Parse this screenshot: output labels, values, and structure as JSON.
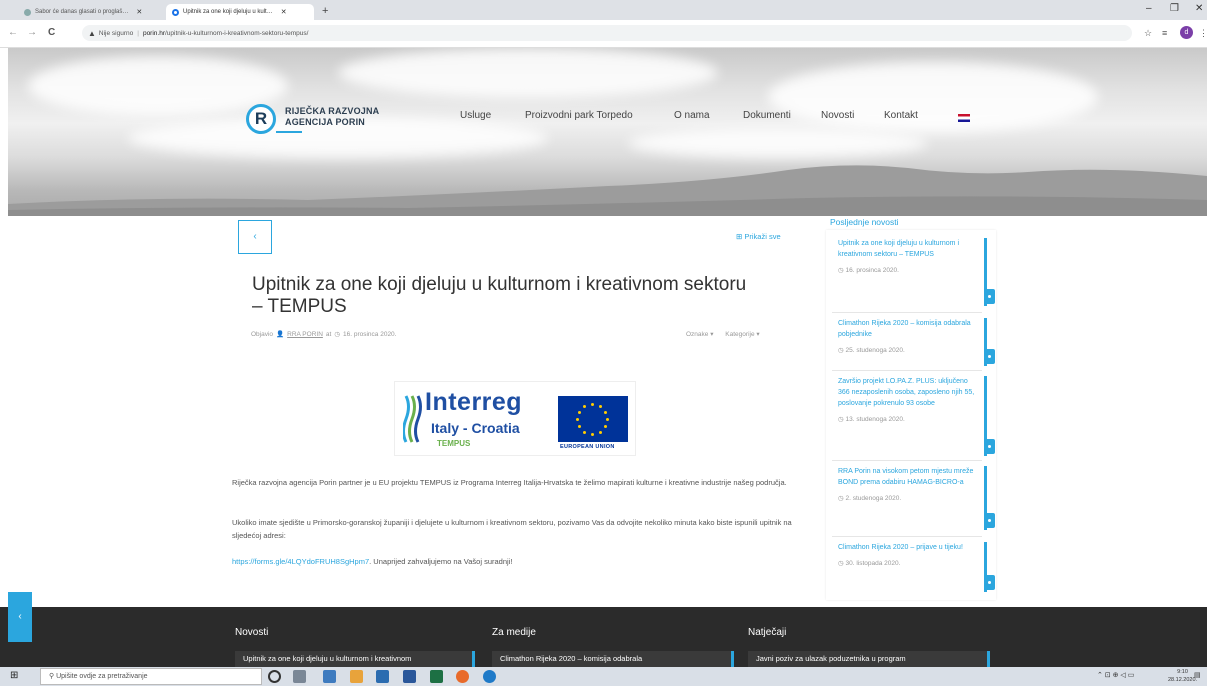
{
  "browser": {
    "tabs": [
      {
        "title": "Sabor će danas glasati o proglaš…",
        "active": false
      },
      {
        "title": "Upitnik za one koji djeluju u kult…",
        "active": true
      }
    ],
    "new_tab_label": "+",
    "window_controls": {
      "minimize": "–",
      "maximize": "❐",
      "close": "✕"
    },
    "nav": {
      "back": "←",
      "forward": "→",
      "reload": "C"
    },
    "url": {
      "security_icon": "warning-triangle-icon",
      "security_text": "Nije sigurno",
      "host": "porin.hr",
      "path": "/upitnik-u-kulturnom-i-kreativnom-sektoru-tempus/"
    },
    "toolbar_icons": {
      "star": "☆",
      "reading_list": "≡",
      "profile": "d",
      "menu": "⋮"
    }
  },
  "site": {
    "logo_letter": "R",
    "logo_line1": "RIJEČKA RAZVOJNA",
    "logo_line2": "AGENCIJA PORIN",
    "menu": [
      "Usluge",
      "Proizvodni park Torpedo",
      "O nama",
      "Dokumenti",
      "Novosti",
      "Kontakt"
    ]
  },
  "article": {
    "back_label": "‹",
    "show_all_label": "Prikaži sve",
    "title": "Upitnik za one koji djeluju u kulturnom i kreativnom sektoru – TEMPUS",
    "meta": {
      "posted_prefix": "Objavio",
      "author": "RRA PORIN",
      "at": "at",
      "date": "16. prosinca 2020.",
      "tags_label": "Oznake",
      "categories_label": "Kategorije"
    },
    "banner": {
      "line1": "Interreg",
      "line2": "Italy - Croatia",
      "line3": "TEMPUS",
      "eu_label": "EUROPEAN UNION"
    },
    "paragraph1": "Riječka razvojna agencija Porin partner je u EU projektu TEMPUS iz Programa Interreg Italija-Hrvatska te želimo mapirati kulturne i kreativne industrije našeg područja.",
    "paragraph2": "Ukoliko imate sjedište u Primorsko-goranskoj županiji i djelujete u kulturnom i kreativnom sektoru, pozivamo Vas da odvojite nekoliko minuta kako biste ispunili upitnik na sljedećoj adresi:",
    "link_text": "https://forms.gle/4LQYdoFRUH8SgHpm7",
    "link_suffix": ". Unaprijed zahvaljujemo na Vašoj suradnji!"
  },
  "sidebar": {
    "title": "Posljednje novosti",
    "items": [
      {
        "title": "Upitnik za one koji djeluju u kulturnom i kreativnom sektoru – TEMPUS",
        "date": "16. prosinca 2020."
      },
      {
        "title": "Climathon Rijeka 2020 – komisija odabrala pobjednike",
        "date": "25. studenoga 2020."
      },
      {
        "title": "Završio projekt LO.PA.Z. PLUS: uključeno 366 nezaposlenih osoba, zaposleno njih 55, poslovanje pokrenulo 93 osobe",
        "date": "13. studenoga 2020."
      },
      {
        "title": "RRA Porin na visokom petom mjestu mreže BOND prema odabiru HAMAG-BICRO-a",
        "date": "2. studenoga 2020."
      },
      {
        "title": "Climathon Rijeka 2020 – prijave u tijeku!",
        "date": "30. listopada 2020."
      }
    ]
  },
  "footer": {
    "side_tab": "‹",
    "columns": [
      {
        "title": "Novosti",
        "item": "Upitnik za one koji djeluju u kulturnom i kreativnom"
      },
      {
        "title": "Za medije",
        "item": "Climathon Rijeka 2020 – komisija odabrala"
      },
      {
        "title": "Natječaji",
        "item": "Javni poziv za ulazak poduzetnika u program"
      }
    ]
  },
  "taskbar": {
    "search_placeholder": "Upišite ovdje za pretraživanje",
    "time": "9:10",
    "date": "28.12.2020."
  }
}
